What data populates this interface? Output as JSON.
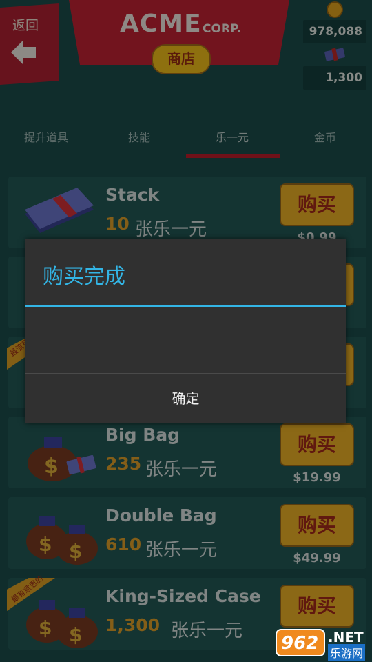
{
  "header": {
    "back_label": "返回",
    "brand": "ACME",
    "brand_suffix": "CORP.",
    "shop_label": "商店",
    "coins": "978,088",
    "cash": "1,300"
  },
  "tabs": [
    {
      "label": "提升道具",
      "active": false
    },
    {
      "label": "技能",
      "active": false
    },
    {
      "label": "乐一元",
      "active": true
    },
    {
      "label": "金币",
      "active": false
    }
  ],
  "cards": [
    {
      "name": "Stack",
      "qty": "10",
      "unit": "张乐一元",
      "buy_label": "购买",
      "price": "$0.99",
      "ribbon": ""
    },
    {
      "name": "",
      "qty": "",
      "unit": "",
      "buy_label": "",
      "price": "",
      "ribbon": ""
    },
    {
      "name": "",
      "qty": "",
      "unit": "",
      "buy_label": "",
      "price": "",
      "ribbon": "最流行"
    },
    {
      "name": "Big Bag",
      "qty": "235",
      "unit": "张乐一元",
      "buy_label": "购买",
      "price": "$19.99",
      "ribbon": ""
    },
    {
      "name": "Double Bag",
      "qty": "610",
      "unit": "张乐一元",
      "buy_label": "购买",
      "price": "$49.99",
      "ribbon": ""
    },
    {
      "name": "King-Sized Case",
      "qty": "1,300",
      "unit": "张乐一元",
      "buy_label": "购买",
      "price": "",
      "ribbon": "最有意思的"
    }
  ],
  "dialog": {
    "title": "购买完成",
    "ok_label": "确定"
  },
  "watermark": {
    "num": "962",
    "net": ".NET",
    "cn": "乐游网"
  },
  "colors": {
    "dialog_accent": "#33b5e5",
    "brand_red": "#c52434",
    "button_gold": "#f0b326"
  }
}
